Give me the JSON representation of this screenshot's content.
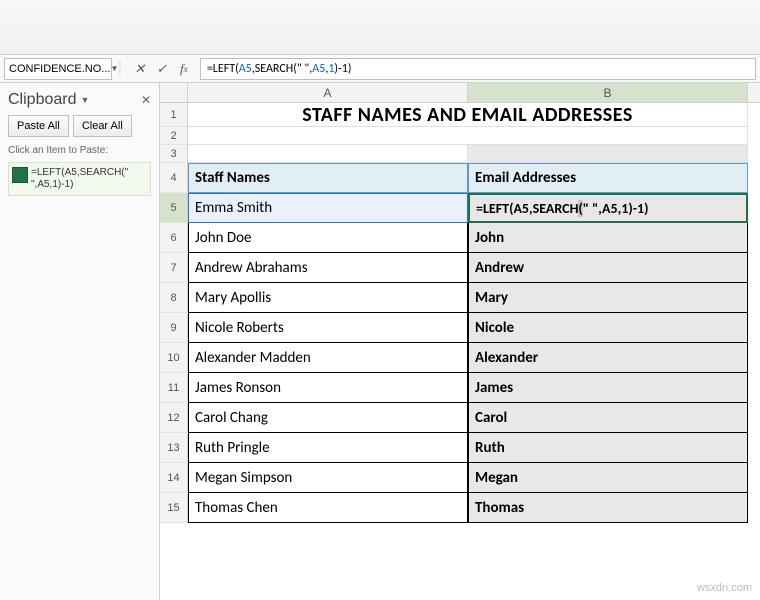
{
  "name_box": "CONFIDENCE.NO...",
  "formula_bar": {
    "prefix": "=LEFT(",
    "ref1": "A5",
    "mid1": ",SEARCH(\" \",",
    "ref2": "A5",
    "mid2": ",",
    "ref3": "1",
    "suffix": ")-1)"
  },
  "clipboard": {
    "title": "Clipboard",
    "paste_all": "Paste All",
    "clear_all": "Clear All",
    "hint": "Click an Item to Paste:",
    "item": "=LEFT(A5,SEARCH(\" \",A5,1)-1)"
  },
  "columns": {
    "A": "A",
    "B": "B"
  },
  "title_row": "STAFF NAMES AND EMAIL ADDRESSES",
  "headers": {
    "A": "Staff Names",
    "B": "Email Addresses"
  },
  "active_formula": {
    "prefix": "=LEFT(A5,SEARCH",
    "cursor": "(",
    "mid": "\" \",A5,1)-1)"
  },
  "rows": [
    {
      "n": 5,
      "a": "Emma Smith",
      "b_formula": true
    },
    {
      "n": 6,
      "a": "John Doe",
      "b": "John"
    },
    {
      "n": 7,
      "a": "Andrew Abrahams",
      "b": "Andrew"
    },
    {
      "n": 8,
      "a": "Mary Apollis",
      "b": "Mary"
    },
    {
      "n": 9,
      "a": "Nicole Roberts",
      "b": "Nicole"
    },
    {
      "n": 10,
      "a": "Alexander Madden",
      "b": "Alexander"
    },
    {
      "n": 11,
      "a": "James Ronson",
      "b": "James"
    },
    {
      "n": 12,
      "a": "Carol Chang",
      "b": "Carol"
    },
    {
      "n": 13,
      "a": "Ruth Pringle",
      "b": "Ruth"
    },
    {
      "n": 14,
      "a": "Megan Simpson",
      "b": "Megan"
    },
    {
      "n": 15,
      "a": "Thomas Chen",
      "b": "Thomas"
    }
  ],
  "watermark": "wsxdn.com"
}
